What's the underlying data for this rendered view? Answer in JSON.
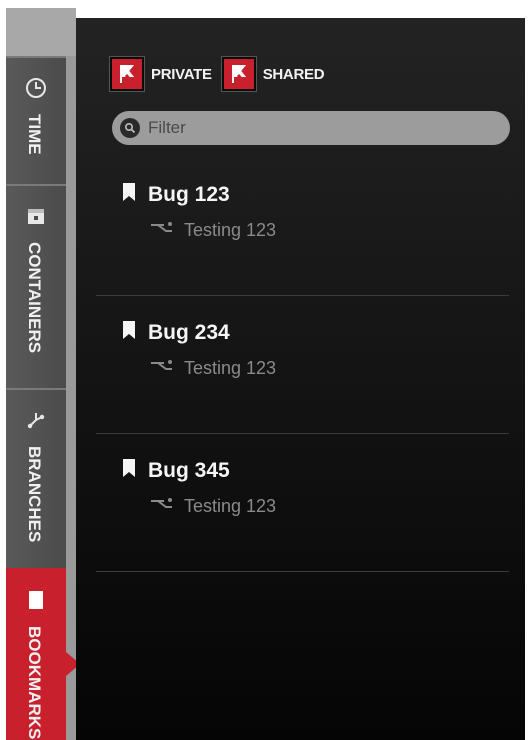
{
  "sidebar": {
    "tabs": [
      {
        "label": "TIME",
        "icon": "clock-icon",
        "active": false
      },
      {
        "label": "CONTAINERS",
        "icon": "container-icon",
        "active": false
      },
      {
        "label": "BRANCHES",
        "icon": "branch-icon",
        "active": false
      },
      {
        "label": "BOOKMARKS",
        "icon": "bookmark-icon",
        "active": true
      }
    ]
  },
  "toggles": {
    "private_label": "PRIVATE",
    "shared_label": "SHARED"
  },
  "filter": {
    "placeholder": "Filter",
    "value": ""
  },
  "bookmarks": [
    {
      "title": "Bug 123",
      "branch": "Testing 123"
    },
    {
      "title": "Bug 234",
      "branch": "Testing 123"
    },
    {
      "title": "Bug 345",
      "branch": "Testing 123"
    }
  ],
  "colors": {
    "accent": "#c8202c",
    "panel_bg": "#1a1a1a",
    "tab_bg": "#505050",
    "filter_bg": "#9c9c9c"
  }
}
